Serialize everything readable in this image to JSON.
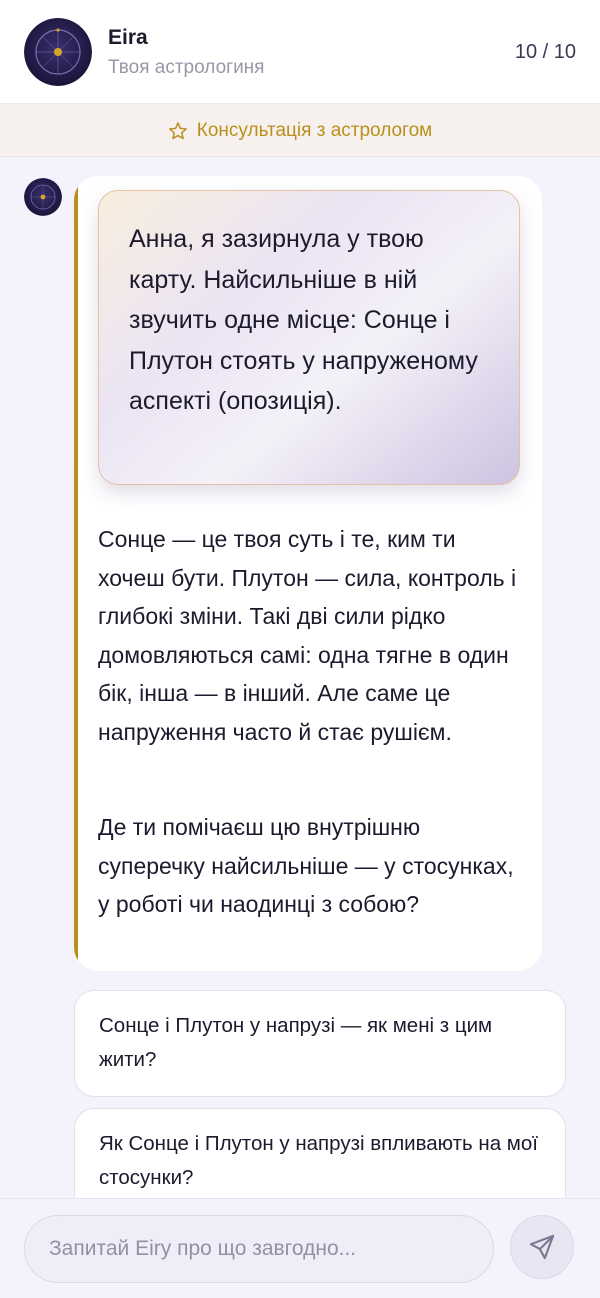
{
  "header": {
    "app_name": "Eira",
    "subtitle": "Твоя астрологиня",
    "counter": "10 / 10"
  },
  "banner": {
    "icon": "star-outline-icon",
    "label": "Консультація з астрологом"
  },
  "message": {
    "highlight": "Анна, я зазирнула у твою карту. Найсильніше в ній звучить одне місце: Сонце і Плутон стоять у напруженому аспекті (опозиція).",
    "paragraph1": "Сонце — це твоя суть і те, ким ти хочеш бути. Плутон — сила, контроль і глибокі зміни. Такі дві сили рідко домовляються самі: одна тягне в один бік, інша — в інший. Але саме це напруження часто й стає рушієм.",
    "paragraph2": "Де ти помічаєш цю внутрішню суперечку найсильніше — у стосунках, у роботі чи наодинці з собою?"
  },
  "suggestions": [
    "Сонце і Плутон у напрузі — як мені з цим жити?",
    "Як Сонце і Плутон у напрузі впливають на мої стосунки?"
  ],
  "input": {
    "placeholder": "Запитай Eiry про що завгодно...",
    "value": ""
  },
  "send_icon": "send-icon",
  "colors": {
    "accent_gold": "#b9901c",
    "avatar_bg": "#1f1842",
    "background": "#f4f2fb"
  }
}
